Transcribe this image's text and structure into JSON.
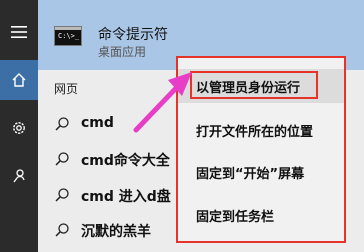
{
  "top_result": {
    "name": "命令提示符",
    "type": "桌面应用",
    "icon_text": "C:\\>_"
  },
  "section_label": "网页",
  "results": [
    {
      "text": "cmd"
    },
    {
      "text": "cmd命令大全"
    },
    {
      "text": "cmd 进入d盘"
    },
    {
      "text": "沉默的羔羊"
    }
  ],
  "context_menu": {
    "items": [
      {
        "label": "以管理员身份运行"
      },
      {
        "label": "打开文件所在的位置"
      },
      {
        "label": "固定到“开始”屏幕"
      },
      {
        "label": "固定到任务栏"
      }
    ]
  },
  "sidebar": {
    "icons": [
      "hamburger-icon",
      "home-icon",
      "settings-icon",
      "feedback-icon"
    ]
  },
  "colors": {
    "highlight_border": "#e5332b",
    "arrow": "#e83ec7",
    "top_result_bg": "#aac6e6",
    "sidebar_active": "#3b6fa6"
  }
}
